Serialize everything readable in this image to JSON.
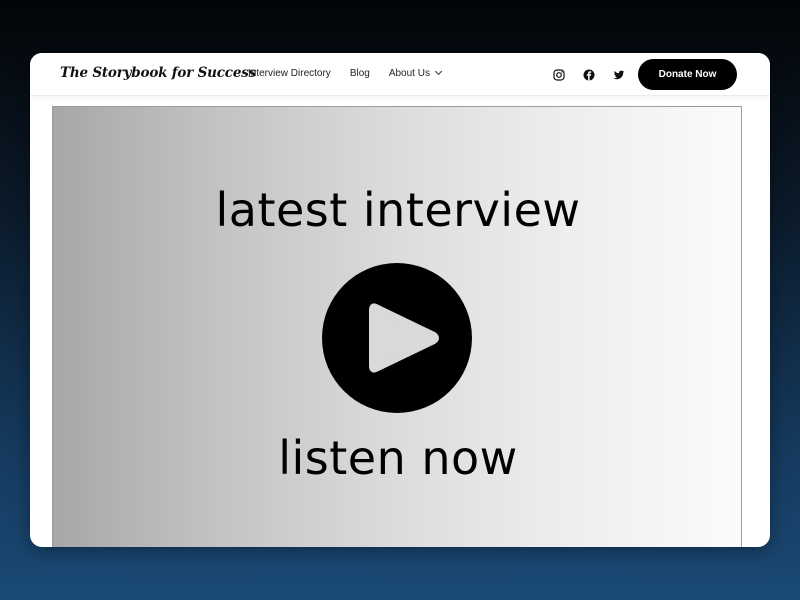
{
  "site": {
    "logo_text": "The Storybook for Success"
  },
  "nav": {
    "items": [
      {
        "label": "Interview Directory"
      },
      {
        "label": "Blog"
      },
      {
        "label": "About Us",
        "has_dropdown": true
      }
    ]
  },
  "social": [
    {
      "icon": "instagram-icon"
    },
    {
      "icon": "facebook-icon"
    },
    {
      "icon": "twitter-icon"
    }
  ],
  "header": {
    "donate_label": "Donate Now"
  },
  "hero": {
    "title": "latest interview",
    "cta": "listen now",
    "play_icon": "play-icon"
  },
  "colors": {
    "page_background_top": "#030507",
    "page_background_bottom": "#1a4a75",
    "button_background": "#000000",
    "button_text": "#ffffff",
    "hero_gradient_left": "#a7a7a7",
    "hero_gradient_right": "#fbfbfb"
  }
}
